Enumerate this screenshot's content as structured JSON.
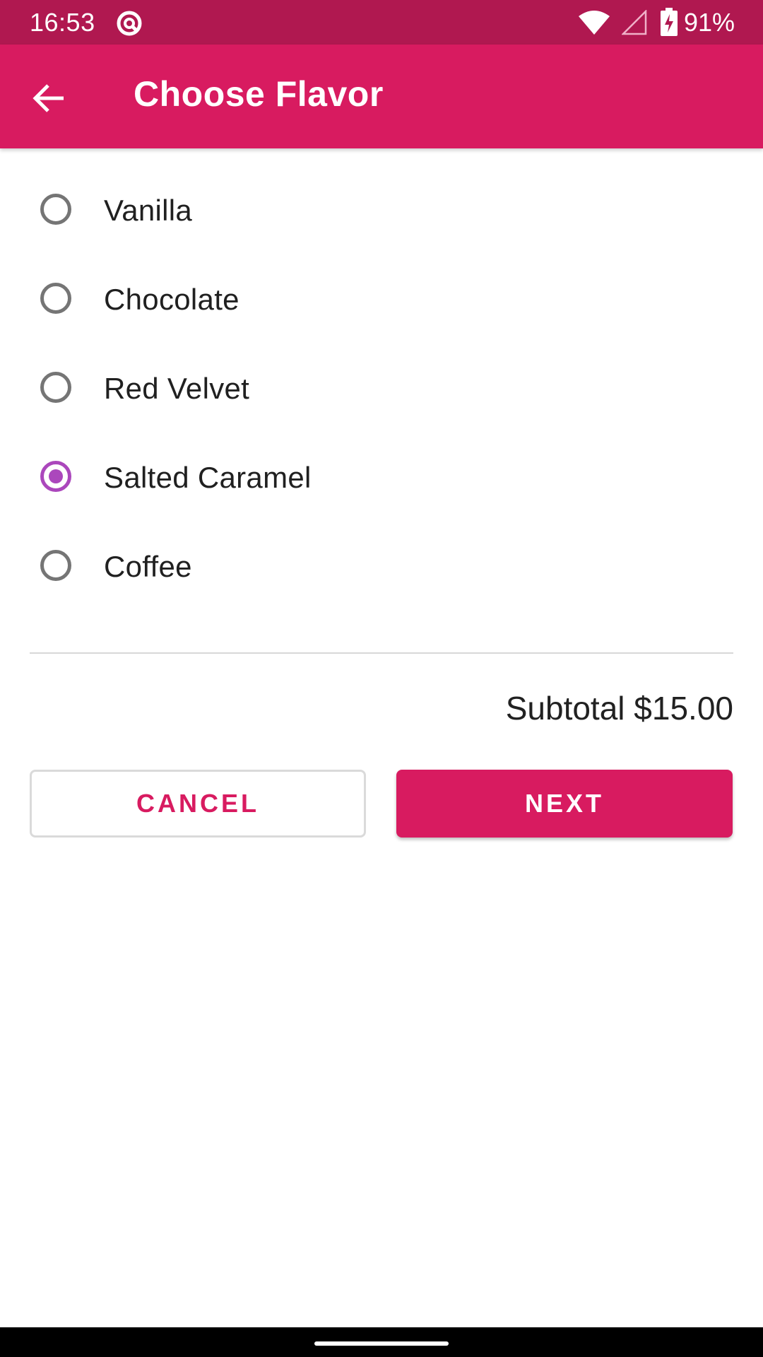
{
  "status_bar": {
    "time": "16:53",
    "battery": "91%",
    "icons": [
      "sync-icon",
      "wifi-icon",
      "signal-icon",
      "battery-charging-icon"
    ]
  },
  "app_bar": {
    "title": "Choose Flavor",
    "back_icon": "arrow-back-icon"
  },
  "flavors": {
    "options": [
      {
        "label": "Vanilla",
        "checked": false
      },
      {
        "label": "Chocolate",
        "checked": false
      },
      {
        "label": "Red Velvet",
        "checked": false
      },
      {
        "label": "Salted Caramel",
        "checked": true
      },
      {
        "label": "Coffee",
        "checked": false
      }
    ]
  },
  "summary": {
    "subtotal": "Subtotal $15.00"
  },
  "actions": {
    "cancel_label": "CANCEL",
    "next_label": "NEXT"
  },
  "colors": {
    "primary": "#d81b60",
    "primary_dark": "#b01850",
    "radio_checked": "#ab47bc",
    "radio_unchecked": "#757575"
  }
}
